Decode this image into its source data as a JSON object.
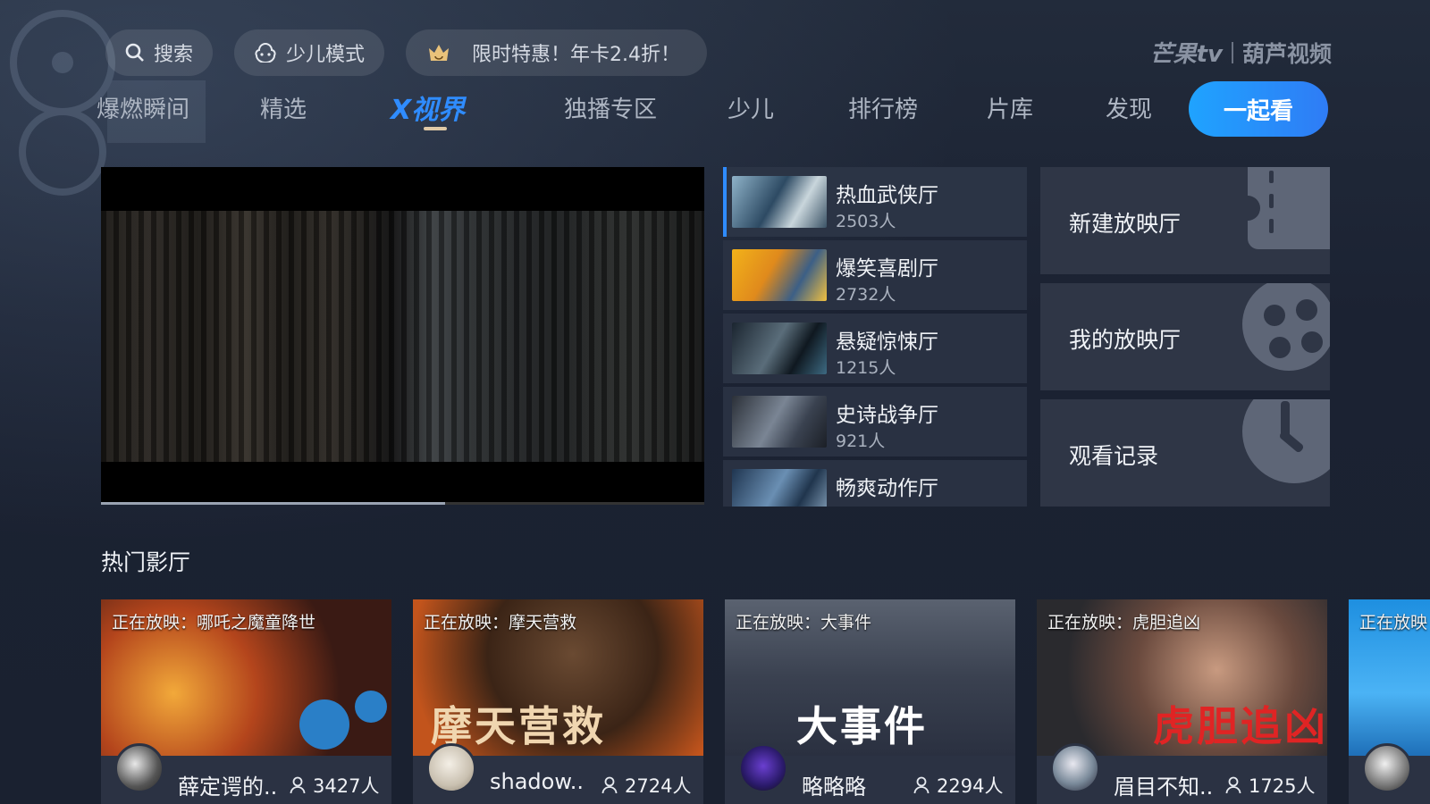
{
  "top": {
    "search": "搜索",
    "kids_mode": "少儿模式",
    "promo": "限时特惠！年卡2.4折！",
    "brand_left": "芒果tv",
    "brand_right": "葫芦视频"
  },
  "nav": {
    "items": [
      "爆燃瞬间",
      "精选",
      "X视界",
      "独播专区",
      "少儿",
      "排行榜",
      "片库",
      "发现"
    ],
    "active_index": 2,
    "together": "一起看"
  },
  "player": {
    "progress": 0.57
  },
  "halls": [
    {
      "name": "热血武侠厅",
      "count": "2503人"
    },
    {
      "name": "爆笑喜剧厅",
      "count": "2732人"
    },
    {
      "name": "悬疑惊悚厅",
      "count": "1215人"
    },
    {
      "name": "史诗战争厅",
      "count": "921人"
    },
    {
      "name": "畅爽动作厅",
      "count": ""
    }
  ],
  "actions": [
    {
      "label": "新建放映厅",
      "icon": "ticket-icon"
    },
    {
      "label": "我的放映厅",
      "icon": "film-reel-icon"
    },
    {
      "label": "观看记录",
      "icon": "clock-icon"
    }
  ],
  "section_title": "热门影厅",
  "rooms": [
    {
      "now": "正在放映：哪吒之魔童降世",
      "user": "薛定谔的..",
      "count": "3427人"
    },
    {
      "now": "正在放映：摩天营救",
      "title_art": "摩天营救",
      "user": "shadow..",
      "count": "2724人"
    },
    {
      "now": "正在放映：大事件",
      "title_art": "大事件",
      "user": "略略略",
      "count": "2294人"
    },
    {
      "now": "正在放映：虎胆追凶",
      "title_art": "虎胆追凶",
      "user": "眉目不知..",
      "count": "1725人"
    },
    {
      "now": "正在放映",
      "user": "",
      "count": ""
    }
  ],
  "colors": {
    "accent": "#2f8cff",
    "bg": "#1b2232",
    "tile": "#2f3646"
  }
}
